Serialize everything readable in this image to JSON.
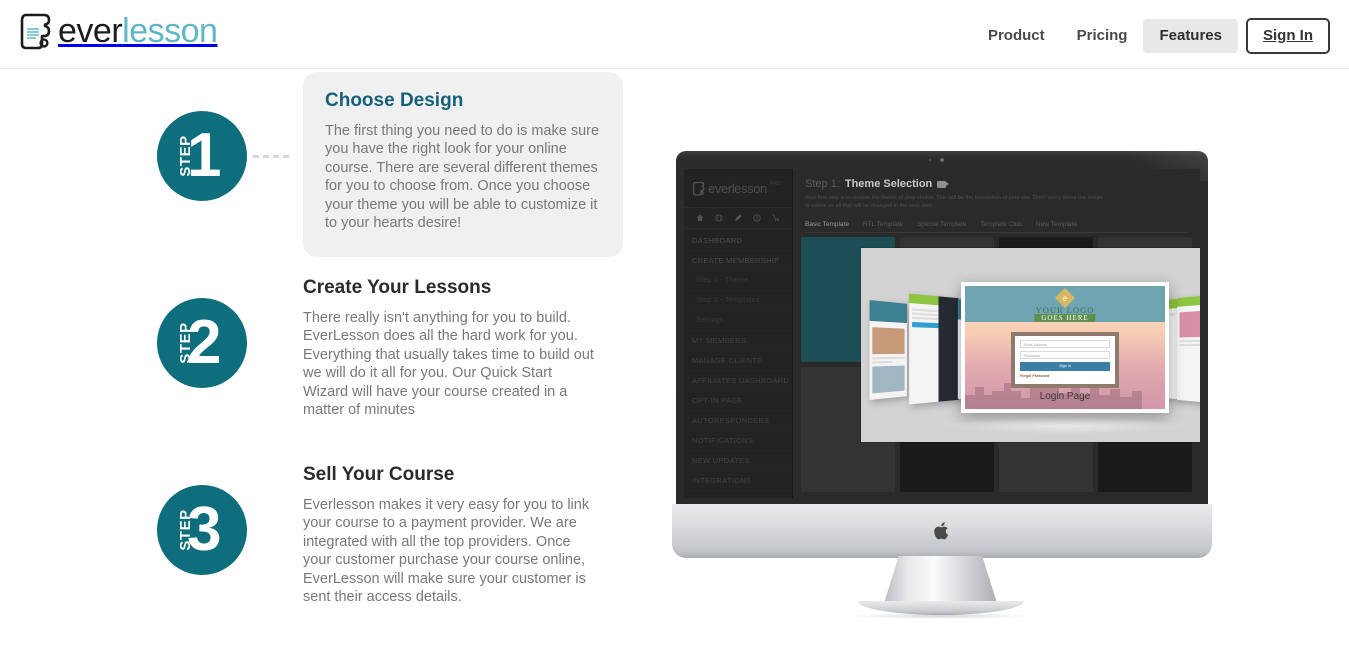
{
  "brand": {
    "name_part1": "ever",
    "name_part2": "lesson",
    "logo_icon": "scroll-icon",
    "accent_teal": "#0f6e7d",
    "logo_light_blue": "#5fb7c6"
  },
  "header": {
    "nav": [
      {
        "label": "Product",
        "active": false
      },
      {
        "label": "Pricing",
        "active": false
      },
      {
        "label": "Features",
        "active": true
      }
    ],
    "signin_label": "Sign In"
  },
  "steps": [
    {
      "badge_word": "STEP",
      "badge_number": "1",
      "title": "Choose Design",
      "text": "The first thing you need to do is make sure you have the right look for your online course. There are several different themes for you to choose from. Once you choose your theme you will be able to customize it to your hearts desire!",
      "carded": true,
      "title_color": "#17607b"
    },
    {
      "badge_word": "STEP",
      "badge_number": "2",
      "title": "Create Your Lessons",
      "text": "There really isn't anything for you to build. EverLesson does all the hard work for you. Everything that usually takes time to build out we will do it all for you. Our Quick Start Wizard will have your course created in a matter of minutes",
      "carded": false,
      "title_color": "#2b2b2b"
    },
    {
      "badge_word": "STEP",
      "badge_number": "3",
      "title": "Sell Your Course",
      "text": "Everlesson makes it very easy for you to link your course to a payment provider. We are integrated with all the top providers. Once your customer purchase your course online, EverLesson will make sure your customer is sent their access details.",
      "carded": false,
      "title_color": "#2b2b2b"
    }
  ],
  "showcase": {
    "device": "imac-desktop-computer",
    "app": {
      "logo_text": "everlesson",
      "logo_suffix": "PRO",
      "heading_prefix": "Step 1:",
      "heading": "Theme Selection",
      "description": "Your first step is to choose the theme of your choice. This will be the foundation of your site. Don't worry about the image or colors as all that will be changed in the next step.",
      "tabs": [
        {
          "label": "Basic Template",
          "active": true
        },
        {
          "label": "RTL Template",
          "active": false
        },
        {
          "label": "Special Template",
          "active": false
        },
        {
          "label": "Template Club",
          "active": false
        },
        {
          "label": "New Template",
          "active": false
        }
      ],
      "sidebar_items": [
        "DASHBOARD",
        "CREATE MEMBERSHIP",
        "Step 1 - Theme",
        "Step 2 - Templates",
        "Settings",
        "MY MEMBERS",
        "MANAGE CLIENTS",
        "AFFILIATES DASHBOARD",
        "OPT-IN PAGE",
        "AUTORESPONDERS",
        "NOTIFICATIONS",
        "NEW UPDATES",
        "INTEGRATIONS"
      ]
    },
    "lightbox": {
      "caption": "Login Page",
      "logo_line1": "YOUR LOGO",
      "logo_line2": "GOES HERE",
      "email_placeholder": "Email Address",
      "password_placeholder": "Password",
      "signin_button": "Sign In",
      "forgot_link": "Forgot Password"
    }
  }
}
